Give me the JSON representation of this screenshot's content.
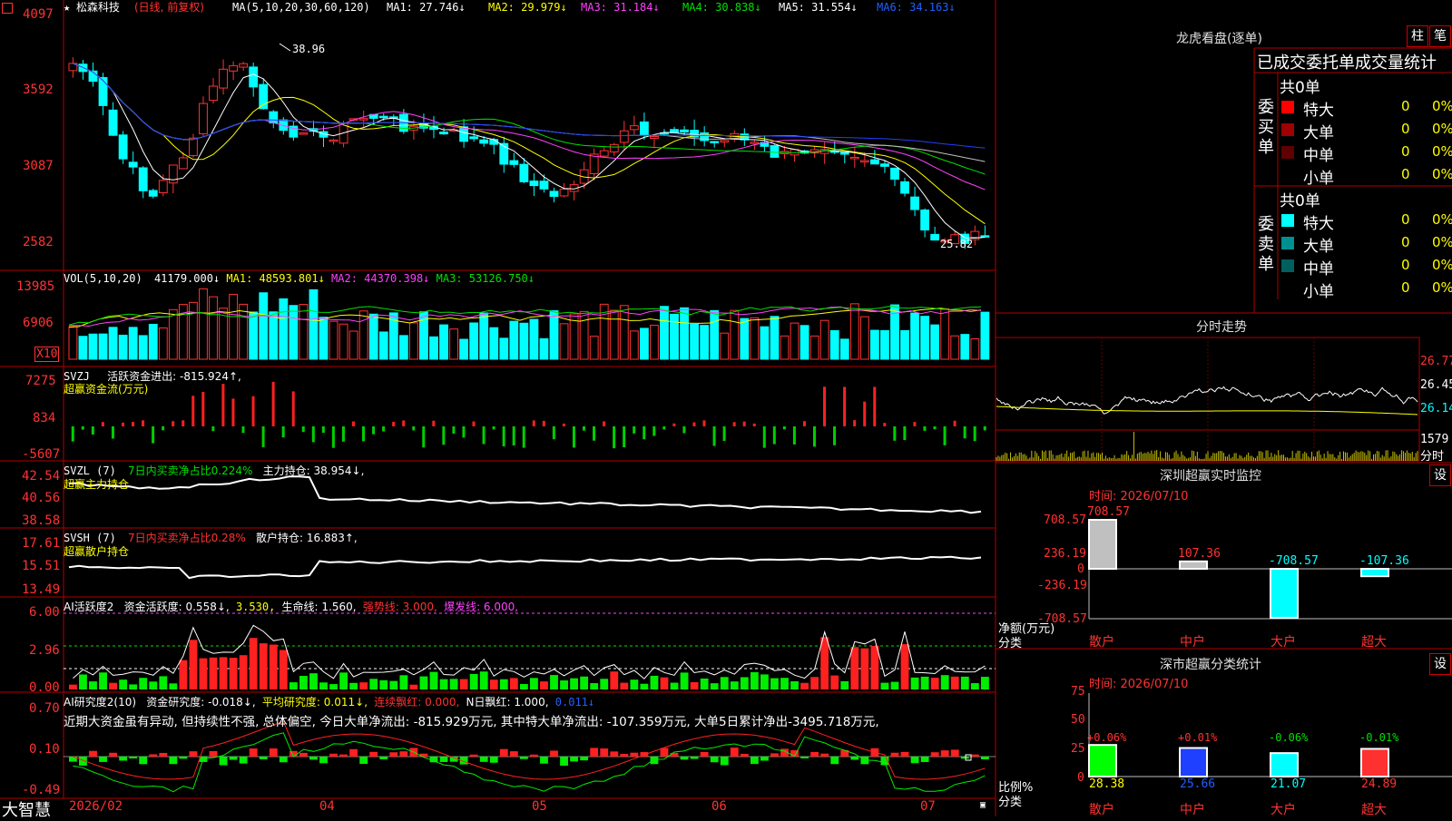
{
  "header": {
    "logo_icon": "square-icon",
    "star": "★",
    "stock_name": "松森科技",
    "period": "(日线, 前复权)",
    "ma_params": "MA(5,10,20,30,60,120)",
    "ma1": "MA1: 27.746↓",
    "ma2": "MA2: 29.979↓",
    "ma3": "MA3: 31.184↓",
    "ma4": "MA4: 30.838↓",
    "ma5": "MA5: 31.554↓",
    "ma6": "MA6: 34.163↓"
  },
  "price_panel": {
    "y_ticks": [
      "4097",
      "3592",
      "3087",
      "2582"
    ],
    "high_label": "38.96",
    "low_label": "25.82"
  },
  "vol_panel": {
    "header": "VOL(5,10,20)",
    "value": "41179.000↓",
    "ma1": "MA1: 48593.801↓",
    "ma2": "MA2: 44370.398↓",
    "ma3": "MA3: 53126.750↓",
    "y_ticks": [
      "13985",
      "6906"
    ],
    "unit": "X10"
  },
  "svzj_panel": {
    "header": "SVZJ",
    "active": "活跃资金进出: -815.924↑,",
    "subtitle": "超赢资金流(万元)",
    "y_ticks": [
      "7275",
      "834",
      "-5607"
    ]
  },
  "svzl_panel": {
    "header": "SVZL (7)",
    "ratio": "7日内买卖净占比0.224%",
    "main": "主力持仓: 38.954↓,",
    "subtitle": "超赢主力持仓",
    "y_ticks": [
      "42.54",
      "40.56",
      "38.58"
    ]
  },
  "svsh_panel": {
    "header": "SVSH (7)",
    "ratio": "7日内买卖净占比0.28%",
    "retail": "散户持仓: 16.883↑,",
    "subtitle": "超赢散户持仓",
    "y_ticks": [
      "17.61",
      "15.51",
      "13.49"
    ]
  },
  "ai_active_panel": {
    "header": "AI活跃度2",
    "activity": "资金活跃度: 0.558↓,",
    "v2": "3.530,",
    "life": "生命线: 1.560,",
    "strong": "强势线: 3.000,",
    "burst": "爆发线: 6.000,",
    "y_ticks": [
      "6.00",
      "2.96",
      "0.00"
    ]
  },
  "ai_research_panel": {
    "header": "AI研究度2(10)",
    "research": "资金研究度: -0.018↓,",
    "avg": "平均研究度: 0.011↓,",
    "streak": "连续飘红: 0.000,",
    "nday": "N日飘红: 1.000,",
    "tail": "0.011↓",
    "comment": "近期大资金虽有异动, 但持续性不强, 总体偏空, 今日大单净流出: -815.929万元, 其中特大单净流出: -107.359万元, 大单5日累计净出-3495.718万元,",
    "y_ticks": [
      "0.70",
      "0.10",
      "-0.49"
    ]
  },
  "x_axis": {
    "labels": [
      "2026/02",
      "04",
      "05",
      "06",
      "07"
    ],
    "brand": "大智慧"
  },
  "dragon_tiger": {
    "title": "龙虎看盘(逐单)",
    "btn_bar": "柱",
    "btn_pen": "笔",
    "table_title": "已成交委托单成交量统计",
    "buy_label": "委买单",
    "sell_label": "委卖单",
    "buy_total": "共0单",
    "sell_total": "共0单",
    "buy_rows": [
      {
        "name": "特大",
        "count": "0",
        "pct": "0%",
        "color": "#ff0000"
      },
      {
        "name": "大单",
        "count": "0",
        "pct": "0%",
        "color": "#a00000"
      },
      {
        "name": "中单",
        "count": "0",
        "pct": "0%",
        "color": "#600000"
      },
      {
        "name": "小单",
        "count": "0",
        "pct": "0%",
        "color": ""
      }
    ],
    "sell_rows": [
      {
        "name": "特大",
        "count": "0",
        "pct": "0%",
        "color": "#00ffff"
      },
      {
        "name": "大单",
        "count": "0",
        "pct": "0%",
        "color": "#009090"
      },
      {
        "name": "中单",
        "count": "0",
        "pct": "0%",
        "color": "#006060"
      },
      {
        "name": "小单",
        "count": "0",
        "pct": "0%",
        "color": ""
      }
    ]
  },
  "intraday": {
    "title": "分时走势",
    "y_ticks": [
      "26.77",
      "26.45",
      "26.14"
    ],
    "vol_tick": "1579",
    "vol_unit": "分时"
  },
  "monitor": {
    "title": "深圳超赢实时监控",
    "btn": "设",
    "time": "时间: 2026/07/10",
    "y_ticks": [
      "708.57",
      "236.19",
      "0",
      "-236.19",
      "-708.57"
    ],
    "ylabel": "净额(万元)",
    "xlabel": "分类",
    "categories": [
      "散户",
      "中户",
      "大户",
      "超大"
    ],
    "bar_labels": [
      "708.57",
      "107.36",
      "-708.57",
      "-107.36"
    ]
  },
  "classify": {
    "title": "深市超赢分类统计",
    "btn": "设",
    "time": "时间: 2026/07/10",
    "y_ticks": [
      "75",
      "50",
      "25",
      "0"
    ],
    "ylabel": "比例%",
    "xlabel": "分类",
    "categories": [
      "散户",
      "中户",
      "大户",
      "超大"
    ],
    "top_labels": [
      "+0.06%",
      "+0.01%",
      "-0.06%",
      "-0.01%"
    ],
    "bottom_labels": [
      "28.38",
      "25.66",
      "21.07",
      "24.89"
    ]
  },
  "chart_data": [
    {
      "type": "bar",
      "title": "深圳超赢实时监控",
      "ylabel": "净额(万元)",
      "categories": [
        "散户",
        "中户",
        "大户",
        "超大"
      ],
      "values": [
        708.57,
        107.36,
        -708.57,
        -107.36
      ],
      "ylim": [
        -708.57,
        708.57
      ]
    },
    {
      "type": "bar",
      "title": "深市超赢分类统计",
      "ylabel": "比例%",
      "categories": [
        "散户",
        "中户",
        "大户",
        "超大"
      ],
      "values": [
        28.38,
        25.66,
        21.07,
        24.89
      ],
      "ylim": [
        0,
        75
      ]
    }
  ]
}
